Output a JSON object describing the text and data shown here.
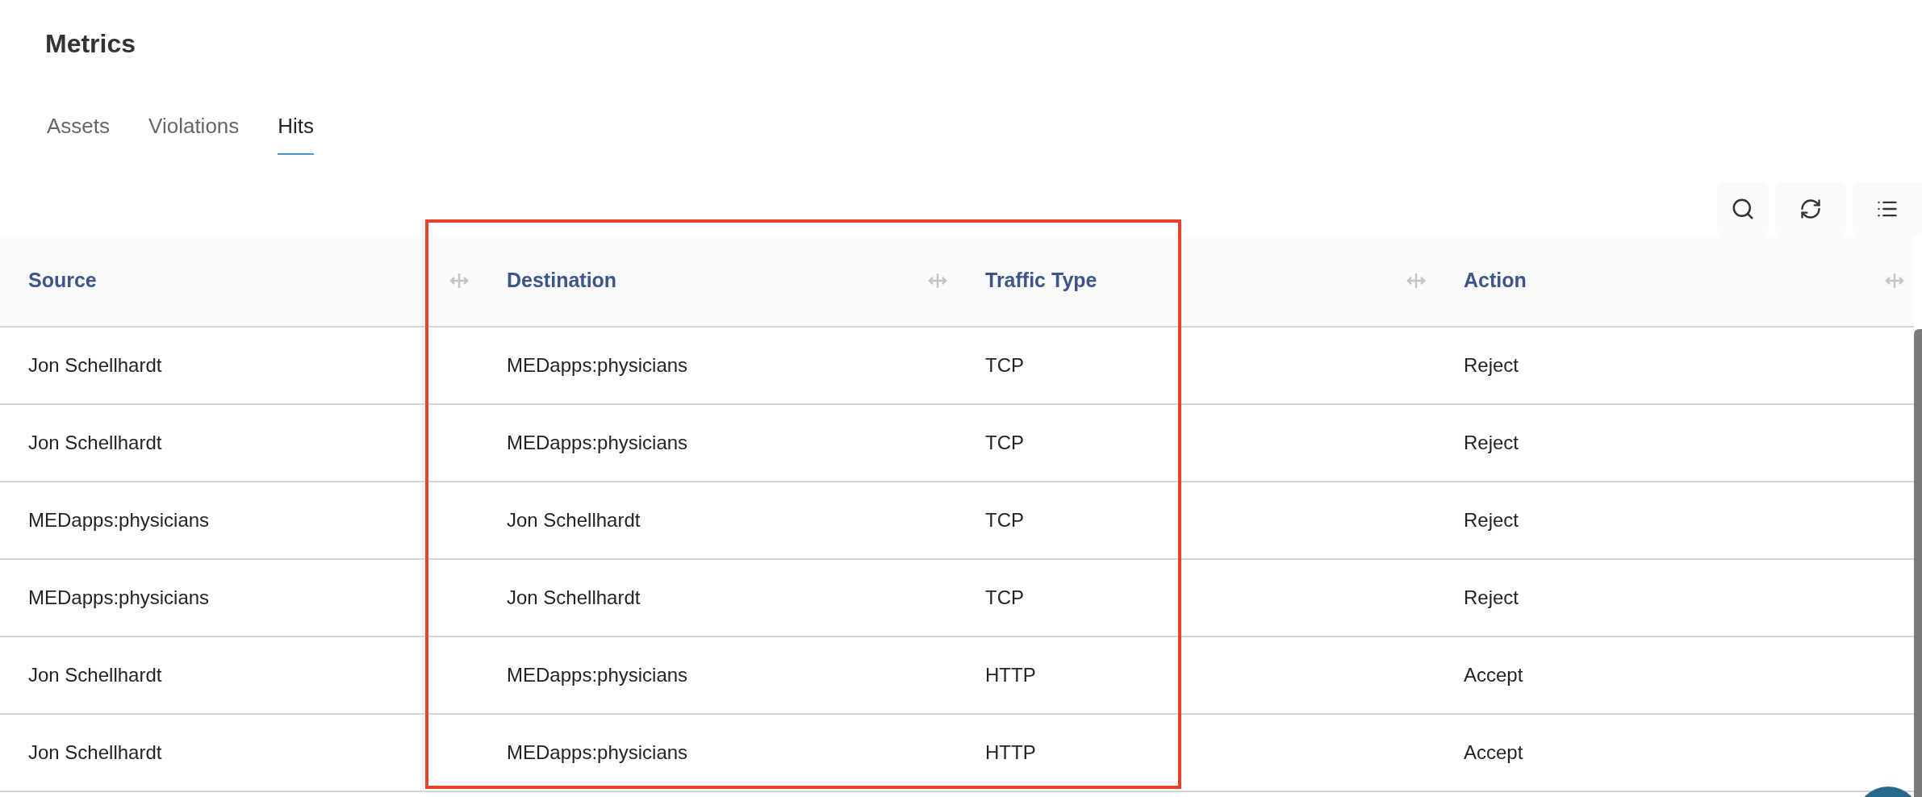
{
  "title": "Metrics",
  "tabs": [
    {
      "label": "Assets",
      "selected": false
    },
    {
      "label": "Violations",
      "selected": false
    },
    {
      "label": "Hits",
      "selected": true
    }
  ],
  "table": {
    "columns": [
      {
        "label": "Source"
      },
      {
        "label": "Destination"
      },
      {
        "label": "Traffic Type"
      },
      {
        "label": "Action"
      }
    ],
    "rows": [
      [
        "Jon Schellhardt",
        "MEDapps:physicians",
        "TCP",
        "Reject"
      ],
      [
        "Jon Schellhardt",
        "MEDapps:physicians",
        "TCP",
        "Reject"
      ],
      [
        "MEDapps:physicians",
        "Jon Schellhardt",
        "TCP",
        "Reject"
      ],
      [
        "MEDapps:physicians",
        "Jon Schellhardt",
        "TCP",
        "Reject"
      ],
      [
        "Jon Schellhardt",
        "MEDapps:physicians",
        "HTTP",
        "Accept"
      ],
      [
        "Jon Schellhardt",
        "MEDapps:physicians",
        "HTTP",
        "Accept"
      ]
    ]
  }
}
